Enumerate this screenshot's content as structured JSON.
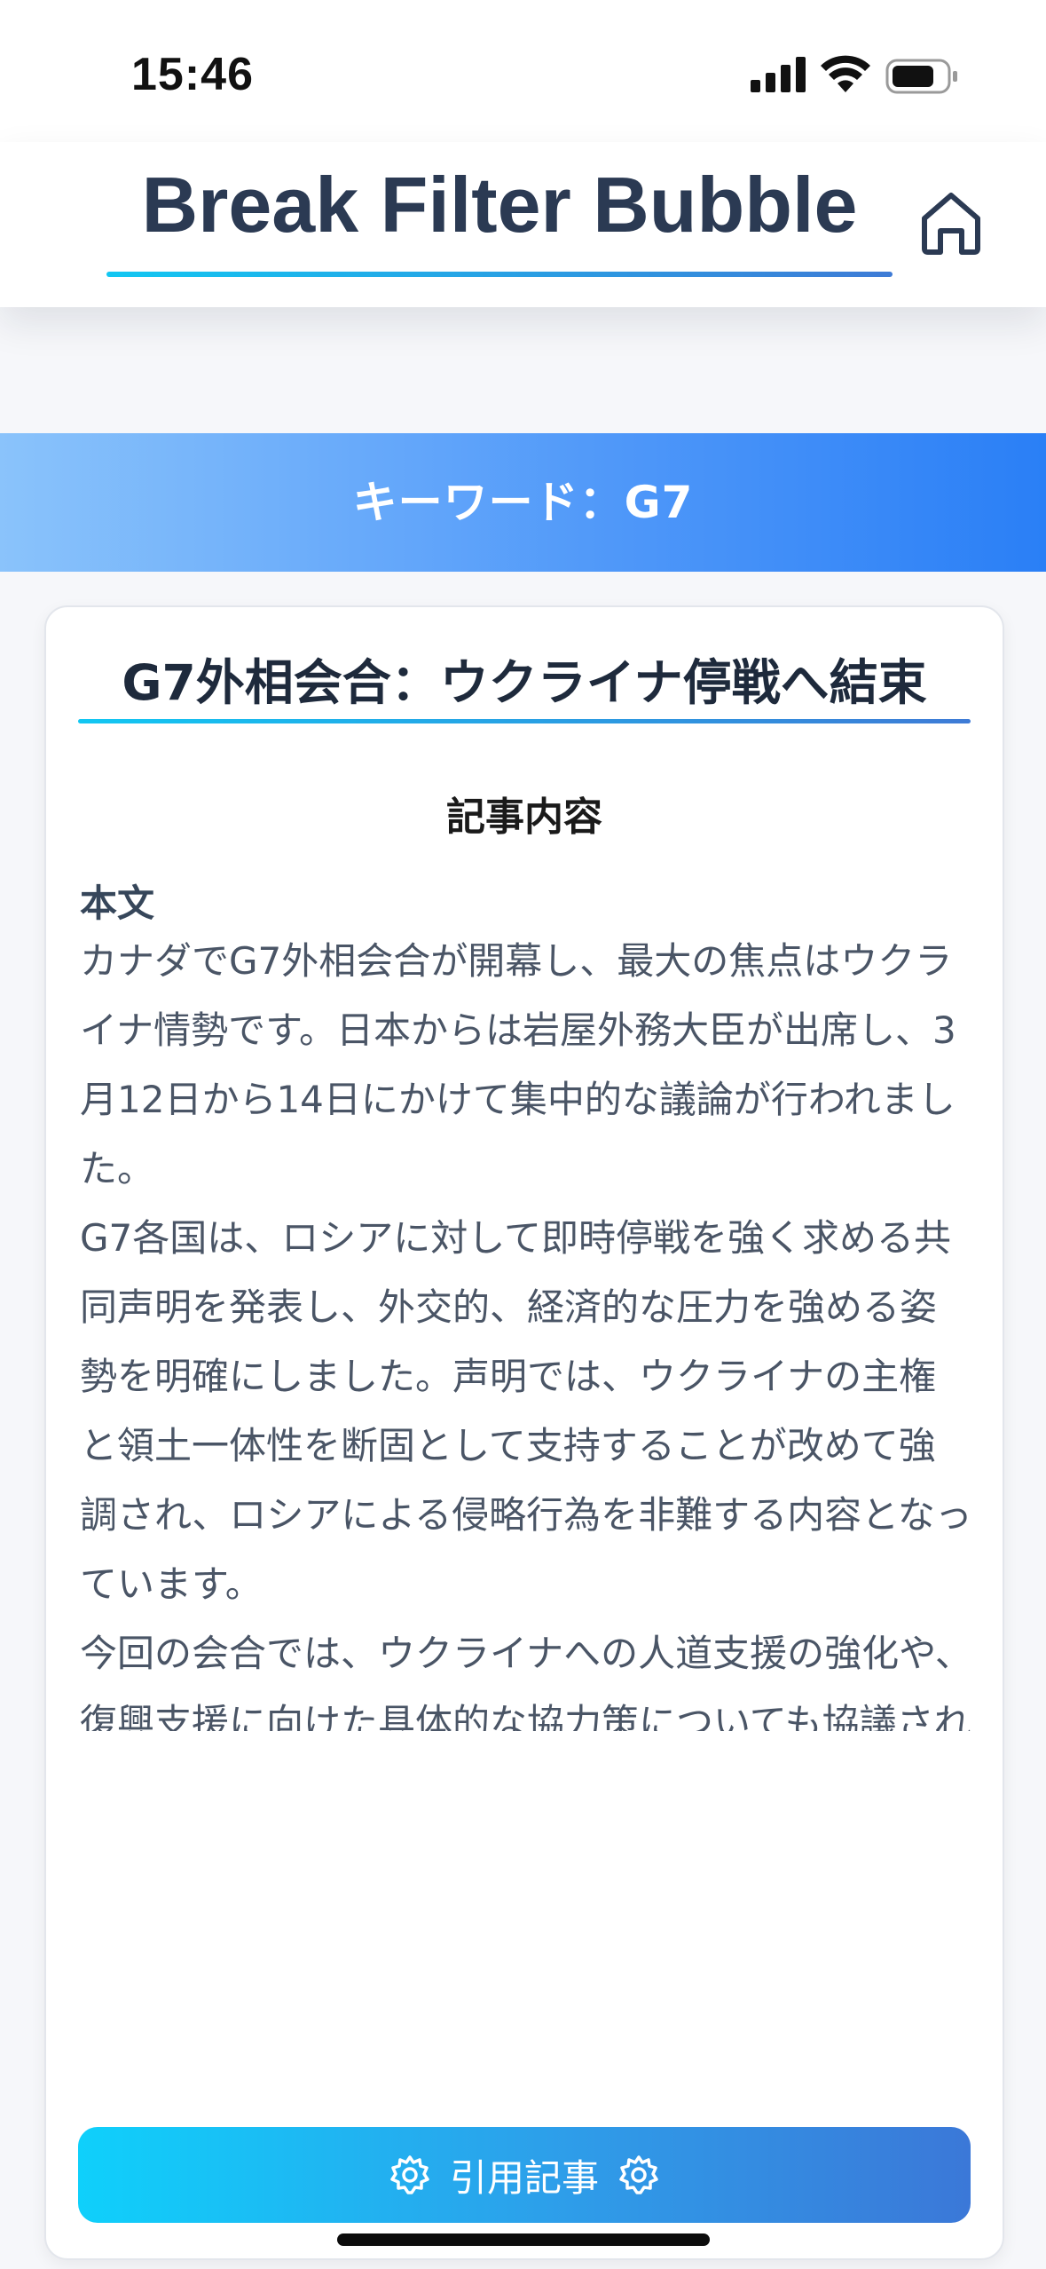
{
  "status_bar": {
    "time": "15:46",
    "icons": [
      "cellular-signal-icon",
      "wifi-icon",
      "battery-icon"
    ]
  },
  "header": {
    "title": "Break Filter Bubble",
    "home_icon": "home-icon"
  },
  "keyword_band": {
    "text": "キーワード：G7"
  },
  "article": {
    "title": "G7外相会合：ウクライナ停戦へ結束",
    "section_heading": "記事内容",
    "body_label": "本文",
    "paragraphs": [
      "カナダでG7外相会合が開幕し、最大の焦点はウクライナ情勢です。日本からは岩屋外務大臣が出席し、3月12日から14日にかけて集中的な議論が行われました。",
      "G7各国は、ロシアに対して即時停戦を強く求める共同声明を発表し、外交的、経済的な圧力を強める姿勢を明確にしました。声明では、ウクライナの主権と領土一体性を断固として支持することが改めて強調され、ロシアによる侵略行為を非難する内容となっています。",
      "今回の会合では、ウクライナへの人道支援の強化や、復興支援に向けた具体的な協力策についても協議されました。エネルギー安全保障や食糧危機といった、紛争によって引き起こされているグローバルな課題についても意見交換が行われ、G7各国が連携して対応していく方針が確認されました。"
    ]
  },
  "quote_button": {
    "label": "引用記事",
    "icon": "gear-icon"
  },
  "colors": {
    "accent_gradient_start": "#12c7f2",
    "accent_gradient_end": "#3e7bd6",
    "keyword_band_start": "#8ac3fb",
    "keyword_band_end": "#2a7ff6",
    "title_text": "#2b3a53"
  }
}
